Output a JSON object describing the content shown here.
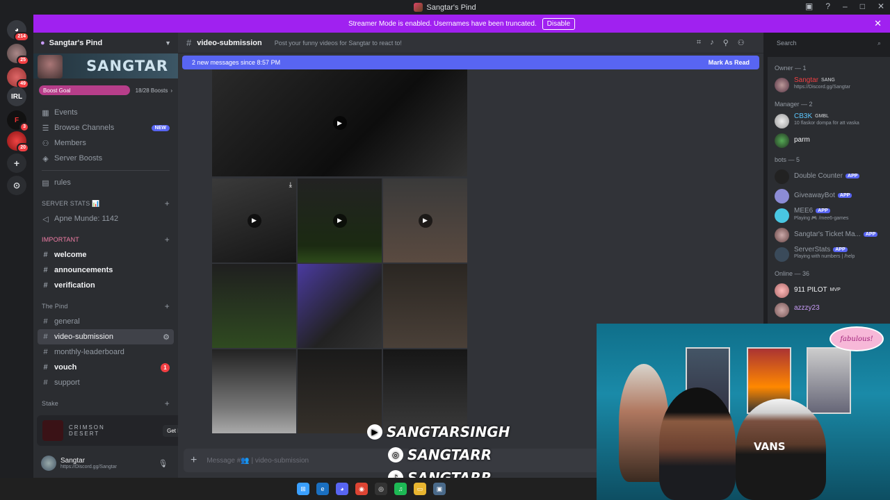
{
  "window": {
    "title": "Sangtar's Pind"
  },
  "banner": {
    "text": "Streamer Mode is enabled. Usernames have been truncated.",
    "button": "Disable"
  },
  "servers": [
    {
      "badge": "214"
    },
    {
      "badge": "25"
    },
    {
      "badge": "49"
    },
    {
      "label": "IRL"
    },
    {
      "label": "F",
      "badge": "3"
    },
    {
      "badge": "20"
    }
  ],
  "guild": {
    "name": "Sangtar's Pind",
    "banner_text": "SANGTAR",
    "boost_goal": "Boost Goal",
    "boost_count": "18/28 Boosts"
  },
  "nav": {
    "events": "Events",
    "browse": "Browse Channels",
    "browse_badge": "NEW",
    "members": "Members",
    "boosts": "Server Boosts",
    "rules": "rules"
  },
  "categories": {
    "stats": "SERVER STATS 📊",
    "stats_channel": "Apne Munde: 1142",
    "important": "IMPORTANT",
    "pind": "The Pind",
    "stake": "Stake"
  },
  "channels": {
    "welcome": "welcome",
    "announcements": "announcements",
    "verification": "verification",
    "general": "general",
    "video_submission": "video-submission",
    "leaderboard": "monthly-leaderboard",
    "vouch": "vouch",
    "vouch_mentions": "1",
    "support": "support"
  },
  "ad": {
    "line1": "CRIMSON",
    "line2": "DESERT",
    "button": "Get Reward!"
  },
  "user": {
    "name": "Sangtar",
    "status": "https://Discord.gg/Sangtar"
  },
  "chat": {
    "channel": "video-submission",
    "topic": "Post your funny videos for Sangtar to react to!",
    "new_messages": "2 new messages since 8:57 PM",
    "mark_read": "Mark As Read",
    "composer_placeholder": "Message #👥 | video-submission"
  },
  "search": {
    "placeholder": "Search"
  },
  "members": {
    "owner_header": "Owner — 1",
    "owner": {
      "name": "Sangtar",
      "tag": "SANG",
      "sub": "https://Discord.gg/Sangtar"
    },
    "manager_header": "Manager — 2",
    "managers": [
      {
        "name": "CB3K",
        "tag": "GMBL",
        "sub": "10 flaskor dompa för att vaska"
      },
      {
        "name": "parm",
        "sub": ""
      }
    ],
    "bots_header": "bots — 5",
    "bots": [
      {
        "name": "Double Counter",
        "tag": "APP",
        "sub": ""
      },
      {
        "name": "GiveawayBot",
        "tag": "APP",
        "sub": ""
      },
      {
        "name": "MEE6",
        "tag": "APP",
        "sub": "Playing 🎮 /mee6-games"
      },
      {
        "name": "Sangtar's Ticket Ma...",
        "tag": "APP",
        "sub": ""
      },
      {
        "name": "ServerStats",
        "tag": "APP",
        "sub": "Playing with numbers | /help"
      }
    ],
    "online_header": "Online — 36",
    "online": [
      {
        "name": "911 PILOT",
        "tag": "MVP",
        "sub": ""
      },
      {
        "name": "azzzy23",
        "sub": ""
      }
    ]
  },
  "overlay": {
    "youtube": "SANGTARSINGH",
    "instagram": "SANGTARR",
    "tiktok": "SANGTARR"
  },
  "webcam": {
    "sign": "fabulous!",
    "hat": "VANS"
  }
}
